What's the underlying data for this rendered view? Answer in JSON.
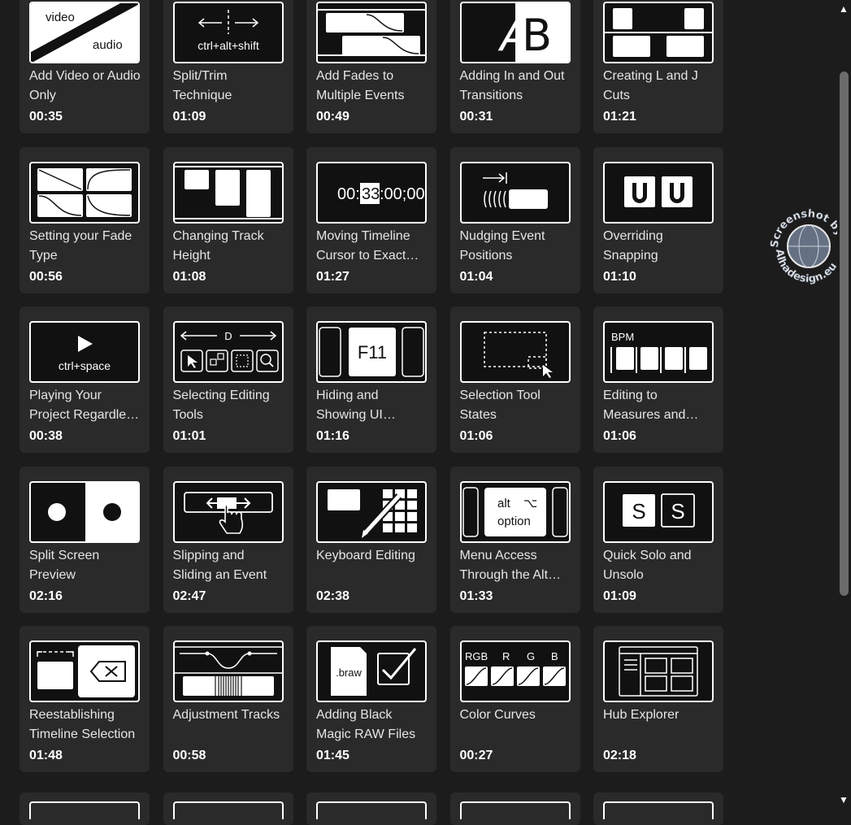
{
  "cards": [
    {
      "title": "Add Video or Audio Only",
      "duration": "00:35",
      "icon": "video-audio-icon",
      "thumb_text": [
        "video",
        "audio"
      ]
    },
    {
      "title": "Split/Trim Technique",
      "duration": "01:09",
      "icon": "split-trim-icon",
      "thumb_text": [
        "ctrl+alt+shift"
      ]
    },
    {
      "title": "Add Fades to Multiple Events",
      "duration": "00:49",
      "icon": "fades-icon",
      "thumb_text": []
    },
    {
      "title": "Adding In and Out Transitions",
      "duration": "00:31",
      "icon": "transition-icon",
      "thumb_text": []
    },
    {
      "title": "Creating L and J Cuts",
      "duration": "01:21",
      "icon": "lj-cuts-icon",
      "thumb_text": []
    },
    {
      "title": "Setting your Fade Type",
      "duration": "00:56",
      "icon": "fade-type-icon",
      "thumb_text": []
    },
    {
      "title": "Changing Track Height",
      "duration": "01:08",
      "icon": "track-height-icon",
      "thumb_text": []
    },
    {
      "title": "Moving Timeline Cursor to Exact…",
      "duration": "01:27",
      "icon": "timecode-icon",
      "thumb_text": [
        "00:",
        "33",
        ":00;00"
      ]
    },
    {
      "title": "Nudging Event Positions",
      "duration": "01:04",
      "icon": "nudge-icon",
      "thumb_text": []
    },
    {
      "title": "Overriding Snapping",
      "duration": "01:10",
      "icon": "snapping-icon",
      "thumb_text": []
    },
    {
      "title": "Playing Your Project Regardle…",
      "duration": "00:38",
      "icon": "play-icon",
      "thumb_text": [
        "ctrl+space"
      ]
    },
    {
      "title": "Selecting Editing Tools",
      "duration": "01:01",
      "icon": "editing-tools-icon",
      "thumb_text": [
        "D"
      ]
    },
    {
      "title": "Hiding and Showing UI…",
      "duration": "01:16",
      "icon": "f11-icon",
      "thumb_text": [
        "F11"
      ]
    },
    {
      "title": "Selection Tool States",
      "duration": "01:06",
      "icon": "selection-tool-icon",
      "thumb_text": []
    },
    {
      "title": "Editing to Measures and…",
      "duration": "01:06",
      "icon": "bpm-icon",
      "thumb_text": [
        "BPM"
      ]
    },
    {
      "title": "Split Screen Preview",
      "duration": "02:16",
      "icon": "split-screen-icon",
      "thumb_text": []
    },
    {
      "title": "Slipping and Sliding an Event",
      "duration": "02:47",
      "icon": "slip-slide-icon",
      "thumb_text": []
    },
    {
      "title": "Keyboard Editing",
      "duration": "02:38",
      "icon": "keyboard-edit-icon",
      "thumb_text": []
    },
    {
      "title": "Menu Access Through the Alt…",
      "duration": "01:33",
      "icon": "alt-option-icon",
      "thumb_text": [
        "alt",
        "⌥",
        "option"
      ]
    },
    {
      "title": "Quick Solo and Unsolo",
      "duration": "01:09",
      "icon": "solo-icon",
      "thumb_text": [
        "S",
        "S"
      ]
    },
    {
      "title": "Reestablishing Timeline Selection",
      "duration": "01:48",
      "icon": "reestablish-icon",
      "thumb_text": []
    },
    {
      "title": "Adjustment Tracks",
      "duration": "00:58",
      "icon": "adjustment-icon",
      "thumb_text": []
    },
    {
      "title": "Adding Black Magic RAW Files",
      "duration": "01:45",
      "icon": "braw-icon",
      "thumb_text": [
        ".braw"
      ]
    },
    {
      "title": "Color Curves",
      "duration": "00:27",
      "icon": "color-curves-icon",
      "thumb_text": [
        "RGB",
        "R",
        "G",
        "B"
      ]
    },
    {
      "title": "Hub Explorer",
      "duration": "02:18",
      "icon": "hub-explorer-icon",
      "thumb_text": []
    }
  ],
  "scrollbar": {
    "up": "▲",
    "down": "▼"
  },
  "watermark": {
    "line1": "Screenshot by",
    "line2": "Alhadesign.eu"
  }
}
